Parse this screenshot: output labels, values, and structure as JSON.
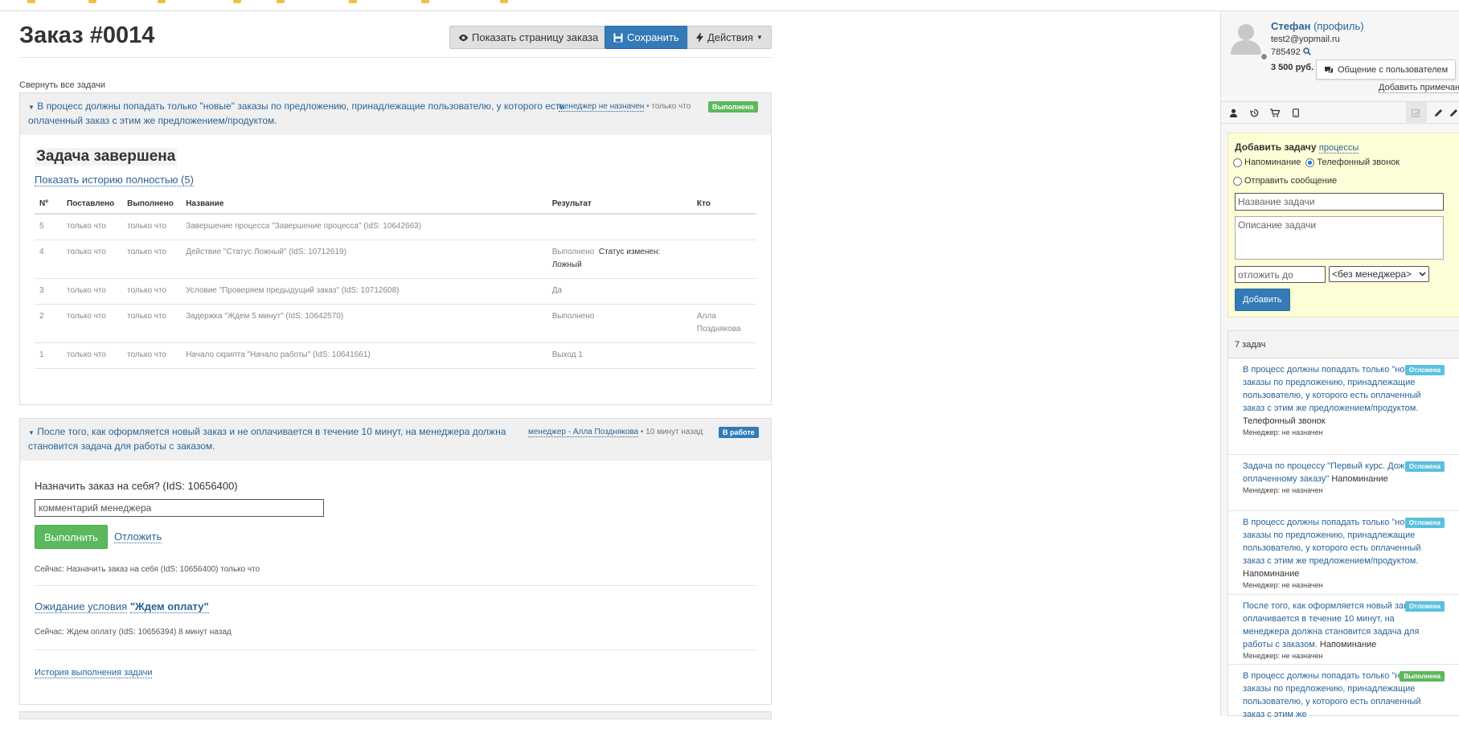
{
  "header": {
    "title": "Заказ #0014",
    "show_order_page": "Показать страницу заказа",
    "save": "Сохранить",
    "actions": "Действия"
  },
  "collapse_all": "Свернуть все задачи",
  "task1": {
    "title": "В процесс должны попадать только \"новые\" заказы по предложению, принадлежащие пользователю, у которого есть оплаченный заказ с этим же предложением/продуктом.",
    "manager": "менеджер не назначен",
    "time": "• только что",
    "status": "Выполнена",
    "completed_title": "Задача завершена",
    "history_link": "Показать историю полностью (5)",
    "columns": [
      "Nº",
      "Поставлено",
      "Выполнено",
      "Название",
      "Результат",
      "Кто"
    ],
    "rows": [
      {
        "n": "5",
        "set": "только что",
        "done": "только что",
        "name": "Завершение процесса \"Завершение процесса\" (IdS: 10642663)",
        "result": "",
        "result2": "",
        "who": ""
      },
      {
        "n": "4",
        "set": "только что",
        "done": "только что",
        "name": "Действие \"Статус Ложный\" (IdS: 10712619)",
        "result": "Выполнено",
        "result2": "Статус изменен: Ложный",
        "who": ""
      },
      {
        "n": "3",
        "set": "только что",
        "done": "только что",
        "name": "Условие \"Проверяем предыдущий заказ\" (IdS: 10712608)",
        "result": "Да",
        "result2": "",
        "who": ""
      },
      {
        "n": "2",
        "set": "только что",
        "done": "только что",
        "name": "Задержка \"Ждем 5 минут\" (IdS: 10642570)",
        "result": "Выполнено",
        "result2": "",
        "who": "Алла Позднякова"
      },
      {
        "n": "1",
        "set": "только что",
        "done": "только что",
        "name": "Начало скрипта \"Начало работы\" (IdS: 10641661)",
        "result": "Выход 1",
        "result2": "",
        "who": ""
      }
    ]
  },
  "task2": {
    "title": "После того, как оформляется новый заказ и не оплачивается в течение 10 минут, на менеджера должна становится задача для работы с заказом.",
    "manager": "менеджер - Алла Позднякова",
    "time": "• 10 минут назад",
    "status": "В работе",
    "question": "Назначить заказ на себя? (IdS: 10656400)",
    "comment_placeholder": "комментарий менеджера",
    "execute": "Выполнить",
    "postpone": "Отложить",
    "now_note": "Сейчас: Назначить заказ на себя (IdS: 10656400) только что",
    "waiting_prefix": "Ожидание условия",
    "waiting_name": "\"Ждем оплату\"",
    "waiting_note": "Сейчас: Ждем оплату (IdS: 10656394) 8 минут назад",
    "exec_history": "История выполнения задачи"
  },
  "user": {
    "name": "Стефан",
    "profile": "(профиль)",
    "email": "test2@yopmail.ru",
    "id": "785492",
    "balance": "3 500 руб.",
    "chat": "Общение с пользователем",
    "add_note": "Добавить примечание"
  },
  "add_task": {
    "title": "Добавить задачу",
    "processes": "процессы",
    "opt_reminder": "Напоминание",
    "opt_call": "Телефонный звонок",
    "opt_message": "Отправить сообщение",
    "name_placeholder": "Название задачи",
    "desc_placeholder": "Описание задачи",
    "defer_placeholder": "отложить до",
    "manager_select": "<без менеджера>",
    "add": "Добавить"
  },
  "tasks": {
    "count": "7 задач",
    "items": [
      {
        "text": "В процесс должны попадать только \"новые\" заказы по предложению, принадлежащие пользователю, у которого есть оплаченный заказ с этим же предложением/продуктом.",
        "type": "Телефонный звонок",
        "manager": "Менеджер: не назначен",
        "status": "Отложена"
      },
      {
        "text": "Задача по процессу \"Первый курс. Дожим по не оплаченному заказу\"",
        "type": "Напоминание",
        "manager": "Менеджер: не назначен",
        "status": "Отложена"
      },
      {
        "text": "В процесс должны попадать только \"новые\" заказы по предложению, принадлежащие пользователю, у которого есть оплаченный заказ с этим же предложением/продуктом.",
        "type": "Напоминание",
        "manager": "Менеджер: не назначен",
        "status": "Отложена"
      },
      {
        "text": "После того, как оформляется новый заказ и не оплачивается в течение 10 минут, на менеджера должна становится задача для работы с заказом.",
        "type": "Напоминание",
        "manager": "Менеджер: не назначен",
        "status": "Отложена"
      },
      {
        "text": "В процесс должны попадать только \"новые\" заказы по предложению, принадлежащие пользователю, у которого есть оплаченный заказ с этим же",
        "type": "",
        "manager": "",
        "status": "Выполнена"
      }
    ]
  },
  "icons": {
    "eye": "eye-icon",
    "save": "floppy-icon",
    "bolt": "bolt-icon",
    "user": "user-icon",
    "history": "history-icon",
    "cart": "cart-icon",
    "phone": "phone-icon",
    "check": "checkbox-icon",
    "pencil": "pencil-icon",
    "chat": "chat-icon",
    "search": "search-icon"
  },
  "colors": {
    "primary": "#337ab7",
    "success": "#5cb85c",
    "info": "#5bc0de",
    "link": "#2a6496",
    "note_bg": "#fdfdd7"
  }
}
